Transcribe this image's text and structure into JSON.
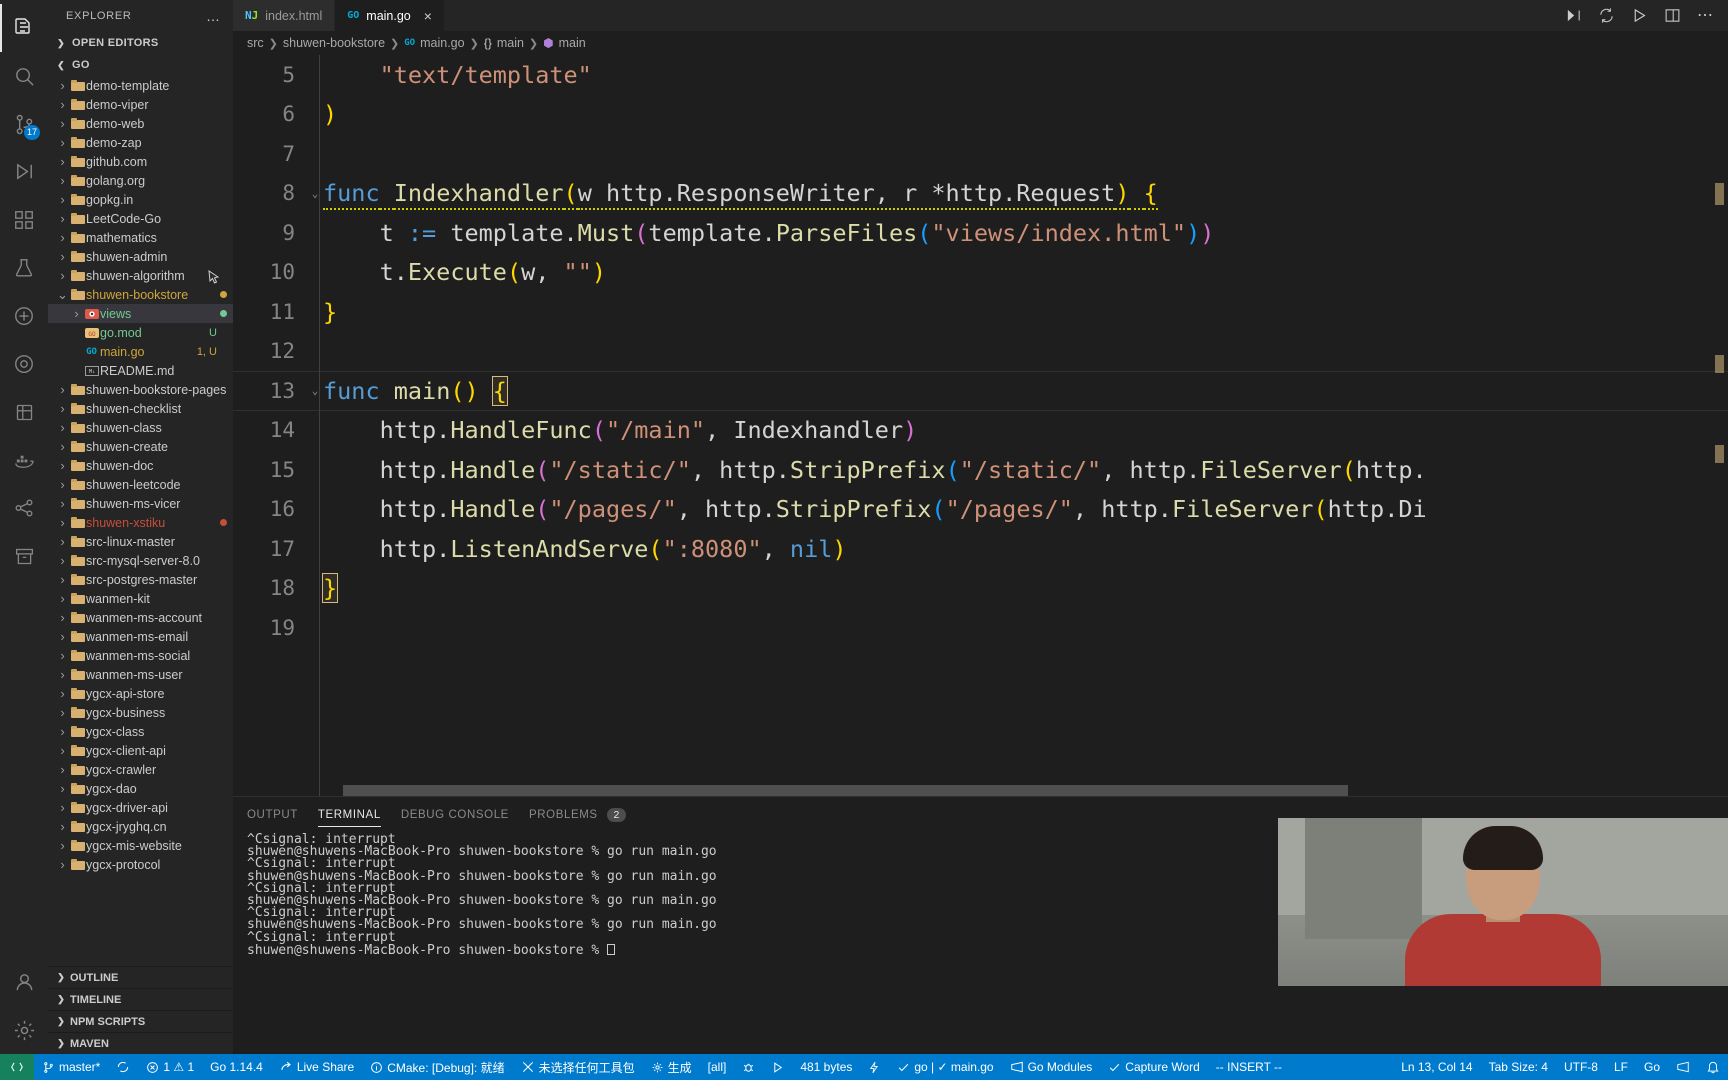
{
  "activitybar": {
    "items": [
      {
        "name": "explorer-icon",
        "glyph": "files"
      },
      {
        "name": "search-icon",
        "glyph": "search"
      },
      {
        "name": "source-control-icon",
        "glyph": "git",
        "badge": "17"
      },
      {
        "name": "run-debug-icon",
        "glyph": "debug"
      },
      {
        "name": "extensions-icon",
        "glyph": "extensions"
      },
      {
        "name": "test-icon",
        "glyph": "beaker"
      },
      {
        "name": "flask-icon",
        "glyph": "flask"
      },
      {
        "name": "circle-icon",
        "glyph": "circle"
      },
      {
        "name": "database-icon",
        "glyph": "database"
      },
      {
        "name": "docker-icon",
        "glyph": "docker"
      },
      {
        "name": "share-icon",
        "glyph": "share"
      },
      {
        "name": "archive-icon",
        "glyph": "archive"
      }
    ],
    "bottom": [
      {
        "name": "accounts-icon",
        "glyph": "account"
      },
      {
        "name": "settings-gear-icon",
        "glyph": "gear"
      }
    ]
  },
  "sidebar": {
    "title": "EXPLORER",
    "more_label": "…",
    "sections": [
      {
        "label": "OPEN EDITORS",
        "collapsed": true
      },
      {
        "label": "GO",
        "collapsed": false
      }
    ],
    "tree": [
      {
        "label": "demo-template",
        "type": "folder",
        "indent": 1
      },
      {
        "label": "demo-viper",
        "type": "folder",
        "indent": 1
      },
      {
        "label": "demo-web",
        "type": "folder",
        "indent": 1
      },
      {
        "label": "demo-zap",
        "type": "folder",
        "indent": 1
      },
      {
        "label": "github.com",
        "type": "folder",
        "indent": 1
      },
      {
        "label": "golang.org",
        "type": "folder",
        "indent": 1
      },
      {
        "label": "gopkg.in",
        "type": "folder",
        "indent": 1
      },
      {
        "label": "LeetCode-Go",
        "type": "folder",
        "indent": 1
      },
      {
        "label": "mathematics",
        "type": "folder",
        "indent": 1
      },
      {
        "label": "shuwen-admin",
        "type": "folder",
        "indent": 1
      },
      {
        "label": "shuwen-algorithm",
        "type": "folder",
        "indent": 1
      },
      {
        "label": "shuwen-bookstore",
        "type": "folder",
        "indent": 1,
        "expanded": true,
        "color": "#cda63c",
        "dot": "#cda63c"
      },
      {
        "label": "views",
        "type": "folder-views",
        "indent": 2,
        "color": "#73c991",
        "dot": "#73c991",
        "selected": true
      },
      {
        "label": "go.mod",
        "type": "gomod",
        "indent": 2,
        "color": "#73c991",
        "meta": "U",
        "meta_color": "#73c991"
      },
      {
        "label": "main.go",
        "type": "go",
        "indent": 2,
        "color": "#cda63c",
        "meta": "1, U",
        "meta_color": "#cda63c"
      },
      {
        "label": "README.md",
        "type": "md",
        "indent": 2
      },
      {
        "label": "shuwen-bookstore-pages",
        "type": "folder",
        "indent": 1
      },
      {
        "label": "shuwen-checklist",
        "type": "folder",
        "indent": 1
      },
      {
        "label": "shuwen-class",
        "type": "folder",
        "indent": 1
      },
      {
        "label": "shuwen-create",
        "type": "folder",
        "indent": 1
      },
      {
        "label": "shuwen-doc",
        "type": "folder",
        "indent": 1
      },
      {
        "label": "shuwen-leetcode",
        "type": "folder",
        "indent": 1
      },
      {
        "label": "shuwen-ms-vicer",
        "type": "folder",
        "indent": 1
      },
      {
        "label": "shuwen-xstiku",
        "type": "folder",
        "indent": 1,
        "color": "#c74e39",
        "dot": "#c74e39"
      },
      {
        "label": "src-linux-master",
        "type": "folder",
        "indent": 1
      },
      {
        "label": "src-mysql-server-8.0",
        "type": "folder",
        "indent": 1
      },
      {
        "label": "src-postgres-master",
        "type": "folder",
        "indent": 1
      },
      {
        "label": "wanmen-kit",
        "type": "folder",
        "indent": 1
      },
      {
        "label": "wanmen-ms-account",
        "type": "folder",
        "indent": 1
      },
      {
        "label": "wanmen-ms-email",
        "type": "folder",
        "indent": 1
      },
      {
        "label": "wanmen-ms-social",
        "type": "folder",
        "indent": 1
      },
      {
        "label": "wanmen-ms-user",
        "type": "folder",
        "indent": 1
      },
      {
        "label": "ygcx-api-store",
        "type": "folder",
        "indent": 1
      },
      {
        "label": "ygcx-business",
        "type": "folder",
        "indent": 1
      },
      {
        "label": "ygcx-class",
        "type": "folder",
        "indent": 1
      },
      {
        "label": "ygcx-client-api",
        "type": "folder",
        "indent": 1
      },
      {
        "label": "ygcx-crawler",
        "type": "folder",
        "indent": 1
      },
      {
        "label": "ygcx-dao",
        "type": "folder",
        "indent": 1
      },
      {
        "label": "ygcx-driver-api",
        "type": "folder",
        "indent": 1
      },
      {
        "label": "ygcx-jryghq.cn",
        "type": "folder",
        "indent": 1
      },
      {
        "label": "ygcx-mis-website",
        "type": "folder",
        "indent": 1
      },
      {
        "label": "ygcx-protocol",
        "type": "folder",
        "indent": 1
      }
    ],
    "bottom_sections": [
      {
        "label": "OUTLINE"
      },
      {
        "label": "TIMELINE"
      },
      {
        "label": "NPM SCRIPTS"
      },
      {
        "label": "MAVEN"
      }
    ]
  },
  "tabs": [
    {
      "label": "index.html",
      "icon": "html-icon",
      "active": false
    },
    {
      "label": "main.go",
      "icon": "go-icon",
      "active": true,
      "close": "×"
    }
  ],
  "breadcrumb": [
    "src",
    "shuwen-bookstore",
    "main.go",
    "main",
    "main"
  ],
  "editor": {
    "lines": [
      {
        "num": "5",
        "indent": 2,
        "tokens": [
          {
            "t": "\"text/template\"",
            "c": "c-str"
          }
        ]
      },
      {
        "num": "6",
        "indent": 0,
        "tokens": [
          {
            "t": ")",
            "c": "c-punc"
          }
        ]
      },
      {
        "num": "7",
        "indent": 0,
        "tokens": []
      },
      {
        "num": "8",
        "indent": 0,
        "fold": true,
        "tokens": [
          {
            "t": "func",
            "c": "c-kw"
          },
          {
            "t": " ",
            "c": "c-plain"
          },
          {
            "t": "Indexhandler",
            "c": "c-fn"
          },
          {
            "t": "(",
            "c": "c-punc"
          },
          {
            "t": "w http.ResponseWriter, r *http.Request",
            "c": "c-plain"
          },
          {
            "t": ")",
            "c": "c-punc"
          },
          {
            "t": " ",
            "c": "c-plain"
          },
          {
            "t": "{",
            "c": "c-punc"
          }
        ]
      },
      {
        "num": "9",
        "indent": 2,
        "tokens": [
          {
            "t": "t ",
            "c": "c-plain"
          },
          {
            "t": ":=",
            "c": "c-kw"
          },
          {
            "t": " template.",
            "c": "c-plain"
          },
          {
            "t": "Must",
            "c": "c-fn"
          },
          {
            "t": "(",
            "c": "c-punc2"
          },
          {
            "t": "template.",
            "c": "c-plain"
          },
          {
            "t": "ParseFiles",
            "c": "c-fn"
          },
          {
            "t": "(",
            "c": "c-punc3"
          },
          {
            "t": "\"views/index.html\"",
            "c": "c-str"
          },
          {
            "t": ")",
            "c": "c-punc3"
          },
          {
            "t": ")",
            "c": "c-punc2"
          }
        ]
      },
      {
        "num": "10",
        "indent": 2,
        "tokens": [
          {
            "t": "t.",
            "c": "c-plain"
          },
          {
            "t": "Execute",
            "c": "c-fn"
          },
          {
            "t": "(",
            "c": "c-punc"
          },
          {
            "t": "w, ",
            "c": "c-plain"
          },
          {
            "t": "\"\"",
            "c": "c-str"
          },
          {
            "t": ")",
            "c": "c-punc"
          }
        ]
      },
      {
        "num": "11",
        "indent": 0,
        "tokens": [
          {
            "t": "}",
            "c": "c-punc"
          }
        ]
      },
      {
        "num": "12",
        "indent": 0,
        "tokens": []
      },
      {
        "num": "13",
        "indent": 0,
        "fold": true,
        "current": true,
        "tokens": [
          {
            "t": "func",
            "c": "c-kw"
          },
          {
            "t": " ",
            "c": "c-plain"
          },
          {
            "t": "main",
            "c": "c-fn"
          },
          {
            "t": "()",
            "c": "c-punc"
          },
          {
            "t": " ",
            "c": "c-plain"
          },
          {
            "t": "{",
            "c": "c-punc",
            "cursor": true
          }
        ]
      },
      {
        "num": "14",
        "indent": 2,
        "tokens": [
          {
            "t": "http.",
            "c": "c-plain"
          },
          {
            "t": "HandleFunc",
            "c": "c-fn"
          },
          {
            "t": "(",
            "c": "c-punc2"
          },
          {
            "t": "\"/main\"",
            "c": "c-str"
          },
          {
            "t": ", Indexhandler",
            "c": "c-plain"
          },
          {
            "t": ")",
            "c": "c-punc2"
          }
        ]
      },
      {
        "num": "15",
        "indent": 2,
        "tokens": [
          {
            "t": "http.",
            "c": "c-plain"
          },
          {
            "t": "Handle",
            "c": "c-fn"
          },
          {
            "t": "(",
            "c": "c-punc2"
          },
          {
            "t": "\"/static/\"",
            "c": "c-str"
          },
          {
            "t": ", http.",
            "c": "c-plain"
          },
          {
            "t": "StripPrefix",
            "c": "c-fn"
          },
          {
            "t": "(",
            "c": "c-punc3"
          },
          {
            "t": "\"/static/\"",
            "c": "c-str"
          },
          {
            "t": ", http.",
            "c": "c-plain"
          },
          {
            "t": "FileServer",
            "c": "c-fn"
          },
          {
            "t": "(",
            "c": "c-punc"
          },
          {
            "t": "http.",
            "c": "c-plain"
          }
        ]
      },
      {
        "num": "16",
        "indent": 2,
        "tokens": [
          {
            "t": "http.",
            "c": "c-plain"
          },
          {
            "t": "Handle",
            "c": "c-fn"
          },
          {
            "t": "(",
            "c": "c-punc2"
          },
          {
            "t": "\"/pages/\"",
            "c": "c-str"
          },
          {
            "t": ", http.",
            "c": "c-plain"
          },
          {
            "t": "StripPrefix",
            "c": "c-fn"
          },
          {
            "t": "(",
            "c": "c-punc3"
          },
          {
            "t": "\"/pages/\"",
            "c": "c-str"
          },
          {
            "t": ", http.",
            "c": "c-plain"
          },
          {
            "t": "FileServer",
            "c": "c-fn"
          },
          {
            "t": "(",
            "c": "c-punc"
          },
          {
            "t": "http.Di",
            "c": "c-plain"
          }
        ]
      },
      {
        "num": "17",
        "indent": 2,
        "tokens": [
          {
            "t": "http.",
            "c": "c-plain"
          },
          {
            "t": "ListenAndServe",
            "c": "c-fn"
          },
          {
            "t": "(",
            "c": "c-punc"
          },
          {
            "t": "\":8080\"",
            "c": "c-str"
          },
          {
            "t": ", ",
            "c": "c-plain"
          },
          {
            "t": "nil",
            "c": "c-blue"
          },
          {
            "t": ")",
            "c": "c-punc"
          }
        ]
      },
      {
        "num": "18",
        "indent": 0,
        "tokens": [
          {
            "t": "}",
            "c": "c-punc",
            "cursor": true
          }
        ]
      },
      {
        "num": "19",
        "indent": 0,
        "tokens": []
      }
    ]
  },
  "panel": {
    "tabs": [
      {
        "label": "OUTPUT",
        "active": false
      },
      {
        "label": "TERMINAL",
        "active": true
      },
      {
        "label": "DEBUG CONSOLE",
        "active": false
      },
      {
        "label": "PROBLEMS",
        "active": false,
        "badge": "2"
      }
    ],
    "terminal_lines": [
      "^Csignal: interrupt",
      "shuwen@shuwens-MacBook-Pro shuwen-bookstore % go run main.go",
      "^Csignal: interrupt",
      "shuwen@shuwens-MacBook-Pro shuwen-bookstore % go run main.go",
      "^Csignal: interrupt",
      "shuwen@shuwens-MacBook-Pro shuwen-bookstore % go run main.go",
      "^Csignal: interrupt",
      "shuwen@shuwens-MacBook-Pro shuwen-bookstore % go run main.go",
      "^Csignal: interrupt",
      "shuwen@shuwens-MacBook-Pro shuwen-bookstore % "
    ]
  },
  "statusbar": {
    "remote_icon": "remote-icon",
    "left": [
      {
        "name": "branch-status",
        "icon": "branch-icon",
        "label": "master*"
      },
      {
        "name": "sync-status",
        "icon": "sync-icon",
        "label": ""
      },
      {
        "name": "problems-status",
        "icon": "error-warning-icon",
        "label": "1 ⚠ 1"
      },
      {
        "name": "go-version-status",
        "icon": "",
        "label": "Go 1.14.4"
      },
      {
        "name": "live-share-status",
        "icon": "liveshare-icon",
        "label": "Live Share"
      },
      {
        "name": "cmake-status",
        "icon": "info-icon",
        "label": "CMake: [Debug]: 就绪"
      },
      {
        "name": "toolkit-status",
        "icon": "tools-icon",
        "label": "未选择任何工具包"
      },
      {
        "name": "build-status",
        "icon": "gear-icon",
        "label": "生成"
      },
      {
        "name": "target-status",
        "icon": "",
        "label": "[all]"
      },
      {
        "name": "debug-target-status",
        "icon": "bug-icon",
        "label": ""
      },
      {
        "name": "run-status",
        "icon": "play-icon",
        "label": ""
      },
      {
        "name": "filesize-status",
        "icon": "",
        "label": "481 bytes"
      },
      {
        "name": "lightning-status",
        "icon": "zap-icon",
        "label": ""
      },
      {
        "name": "go-check-status",
        "icon": "check-icon",
        "label": "go | ✓ main.go"
      },
      {
        "name": "go-modules-status",
        "icon": "feedback-icon",
        "label": "Go Modules"
      },
      {
        "name": "capture-word-status",
        "icon": "check-icon",
        "label": "Capture Word"
      },
      {
        "name": "vim-mode-status",
        "icon": "",
        "label": "-- INSERT --"
      }
    ],
    "right": [
      {
        "name": "cursor-position-status",
        "label": "Ln 13, Col 14"
      },
      {
        "name": "tab-size-status",
        "label": "Tab Size: 4"
      },
      {
        "name": "encoding-status",
        "label": "UTF-8"
      },
      {
        "name": "eol-status",
        "label": "LF"
      },
      {
        "name": "language-mode-status",
        "label": "Go"
      },
      {
        "name": "feedback-status",
        "icon": "feedback-icon",
        "label": ""
      },
      {
        "name": "notifications-status",
        "icon": "bell-icon",
        "label": ""
      }
    ]
  },
  "colors": {
    "accent": "#007acc",
    "remote_green": "#16825d",
    "sidebar_bg": "#252526",
    "editor_bg": "#1e1e1e"
  }
}
